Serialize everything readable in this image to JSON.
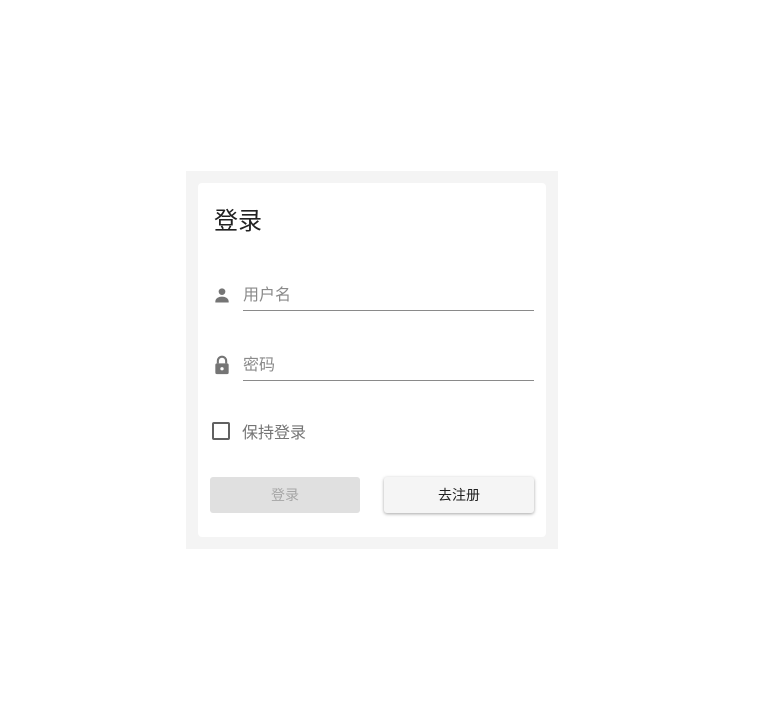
{
  "login_form": {
    "title": "登录",
    "username": {
      "placeholder": "用户名",
      "value": "",
      "icon": "person-icon"
    },
    "password": {
      "placeholder": "密码",
      "value": "",
      "icon": "lock-icon"
    },
    "remember_me": {
      "label": "保持登录",
      "checked": false
    },
    "login_button": {
      "label": "登录",
      "disabled": true
    },
    "register_button": {
      "label": "去注册"
    }
  },
  "colors": {
    "outer_background": "#f4f4f4",
    "card_background": "#ffffff",
    "icon": "#757575",
    "disabled_button": "#e0e0e0",
    "disabled_text": "#a6a6a6"
  }
}
